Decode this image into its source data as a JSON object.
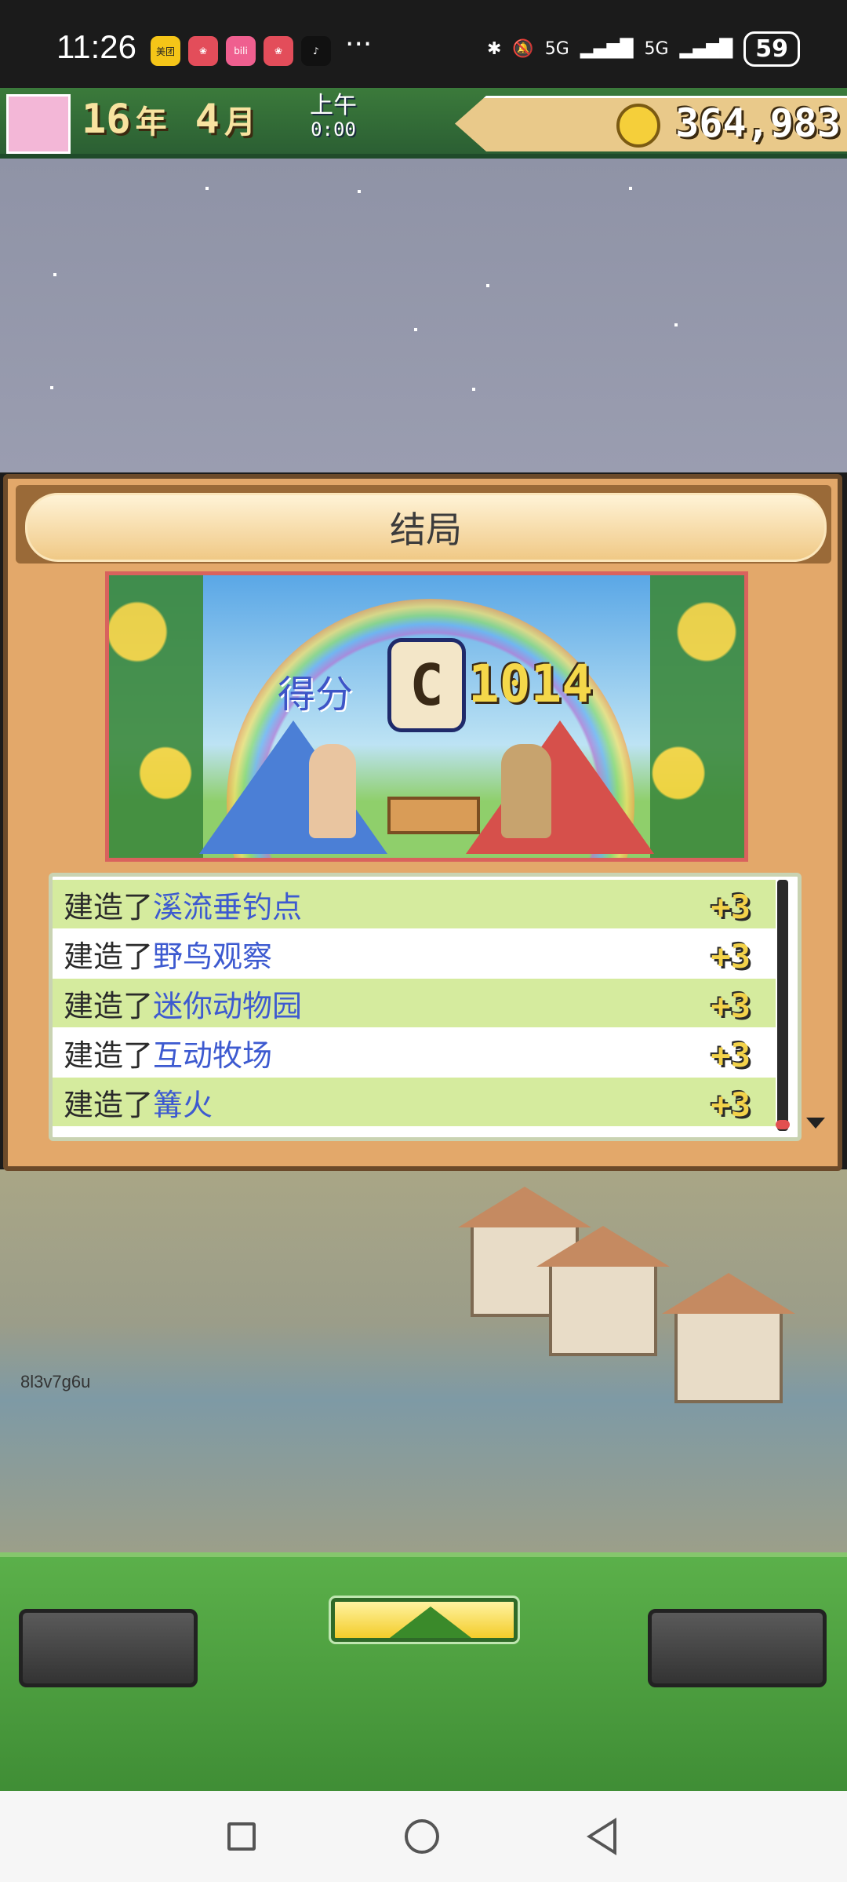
{
  "status_bar": {
    "time": "11:26",
    "app_icons": [
      {
        "name": "meituan-icon",
        "label": "美团",
        "color": "#f5c518"
      },
      {
        "name": "promo-app-icon-1",
        "label": "",
        "color": "#e34d5a"
      },
      {
        "name": "bilibili-icon",
        "label": "bili",
        "color": "#ef5f8f"
      },
      {
        "name": "promo-app-icon-2",
        "label": "",
        "color": "#e34d5a"
      },
      {
        "name": "tiktok-icon",
        "label": "",
        "color": "#111111"
      }
    ],
    "more": "···",
    "signal_labels": [
      "5G",
      "5G"
    ],
    "battery": "59"
  },
  "game_bar": {
    "year_num": "16",
    "year_unit": "年",
    "month_num": "4",
    "month_unit": "月",
    "period": "上午",
    "clock": "0:00",
    "money": "364,983"
  },
  "dialog": {
    "title": "结局",
    "banner": {
      "score_label": "得分",
      "rank": "C",
      "score": "1014"
    },
    "rows": [
      {
        "prefix": "建造了",
        "name": "溪流垂钓点",
        "bonus": "+3"
      },
      {
        "prefix": "建造了",
        "name": "野鸟观察",
        "bonus": "+3"
      },
      {
        "prefix": "建造了",
        "name": "迷你动物园",
        "bonus": "+3"
      },
      {
        "prefix": "建造了",
        "name": "互动牧场",
        "bonus": "+3"
      },
      {
        "prefix": "建造了",
        "name": "篝火",
        "bonus": "+3"
      }
    ]
  },
  "scene": {
    "id_text": "8l3v7g6u"
  },
  "colors": {
    "dialog_bg": "#e3a86a",
    "row_highlight": "#d5eb9e",
    "name_blue": "#3d5ad0",
    "panel_green": "#4fa040"
  }
}
